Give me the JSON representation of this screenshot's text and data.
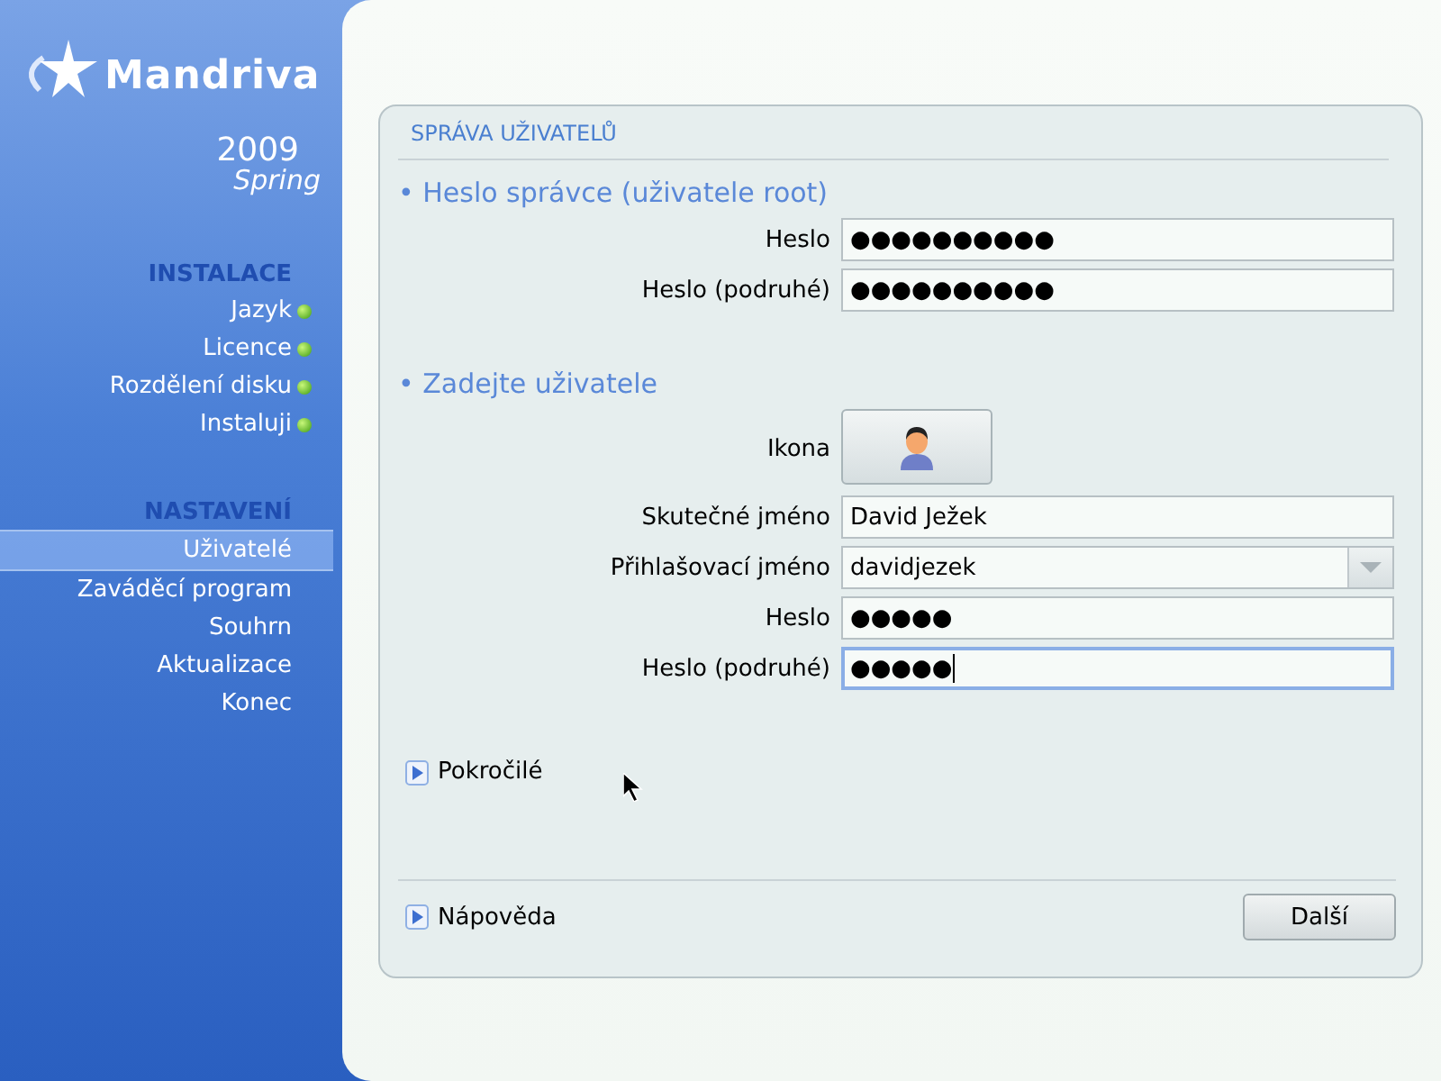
{
  "logo": {
    "brand": "Mandriva",
    "year": "2009",
    "edition": "Spring"
  },
  "sidebar": {
    "sections": [
      {
        "title": "INSTALACE",
        "items": [
          {
            "label": "Jazyk",
            "done": true,
            "selected": false
          },
          {
            "label": "Licence",
            "done": true,
            "selected": false
          },
          {
            "label": "Rozdělení disku",
            "done": true,
            "selected": false
          },
          {
            "label": "Instaluji",
            "done": true,
            "selected": false
          }
        ]
      },
      {
        "title": "NASTAVENÍ",
        "items": [
          {
            "label": "Uživatelé",
            "done": false,
            "selected": true
          },
          {
            "label": "Zaváděcí program",
            "done": false,
            "selected": false
          },
          {
            "label": "Souhrn",
            "done": false,
            "selected": false
          },
          {
            "label": "Aktualizace",
            "done": false,
            "selected": false
          },
          {
            "label": "Konec",
            "done": false,
            "selected": false
          }
        ]
      }
    ]
  },
  "panel": {
    "title": "SPRÁVA UŽIVATELŮ",
    "groups": [
      {
        "title": "• Heslo správce (uživatele root)",
        "rows": [
          {
            "kind": "text",
            "label": "Heslo",
            "value": "●●●●●●●●●●",
            "focused": false
          },
          {
            "kind": "text",
            "label": "Heslo (podruhé)",
            "value": "●●●●●●●●●●",
            "focused": false
          }
        ]
      },
      {
        "title": "• Zadejte uživatele",
        "rows": [
          {
            "kind": "icon",
            "label": "Ikona"
          },
          {
            "kind": "text",
            "label": "Skutečné jméno",
            "value": "David Ježek",
            "focused": false
          },
          {
            "kind": "combo",
            "label": "Přihlašovací jméno",
            "value": "davidjezek",
            "focused": false
          },
          {
            "kind": "text",
            "label": "Heslo",
            "value": "●●●●●",
            "focused": false
          },
          {
            "kind": "text",
            "label": "Heslo (podruhé)",
            "value": "●●●●●",
            "focused": true
          }
        ]
      }
    ],
    "advanced": {
      "label": "Pokročilé",
      "expanded": false
    },
    "help": {
      "label": "Nápověda",
      "expanded": false
    },
    "next_button": "Další"
  }
}
